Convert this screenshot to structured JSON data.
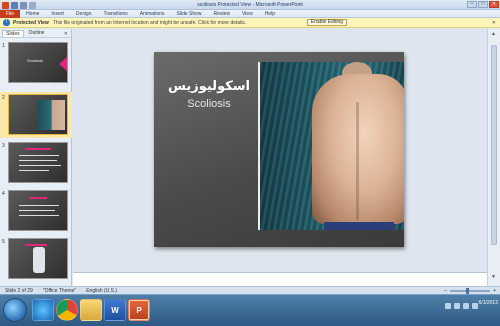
{
  "window": {
    "title": "scoliosis Protected View - Microsoft PowerPoint",
    "min_label": "–",
    "max_label": "□",
    "close_label": "✕"
  },
  "ribbon": {
    "file_label": "File",
    "tabs": [
      "Home",
      "Insert",
      "Design",
      "Transitions",
      "Animations",
      "Slide Show",
      "Review",
      "View",
      "Help"
    ]
  },
  "message_bar": {
    "title": "Protected View",
    "text": "This file originated from an Internet location and might be unsafe. Click for more details.",
    "button_label": "Enable Editing",
    "close_label": "✕",
    "shield_glyph": "!"
  },
  "left_pane": {
    "tabs": [
      "Slides",
      "Outline"
    ],
    "close_label": "✕",
    "thumbnails": [
      {
        "number": "1",
        "caption": "Scoliosis",
        "selected": false
      },
      {
        "number": "2",
        "caption": "",
        "selected": true
      },
      {
        "number": "3",
        "caption": "",
        "selected": false
      },
      {
        "number": "4",
        "caption": "",
        "selected": false
      },
      {
        "number": "5",
        "caption": "",
        "selected": false
      }
    ]
  },
  "slide": {
    "title": "اسکولیوزیس",
    "subtitle": "Scoliosis"
  },
  "notes": {
    "placeholder": ""
  },
  "status_bar": {
    "slide_info": "Slide 2 of 29",
    "theme": "\"Office Theme\"",
    "language": "English (U.S.)",
    "zoom_label": "−",
    "zoom_plus": "+"
  },
  "taskbar": {
    "word_label": "W",
    "ppt_label": "P",
    "time": "",
    "date": "6/1/2012"
  }
}
